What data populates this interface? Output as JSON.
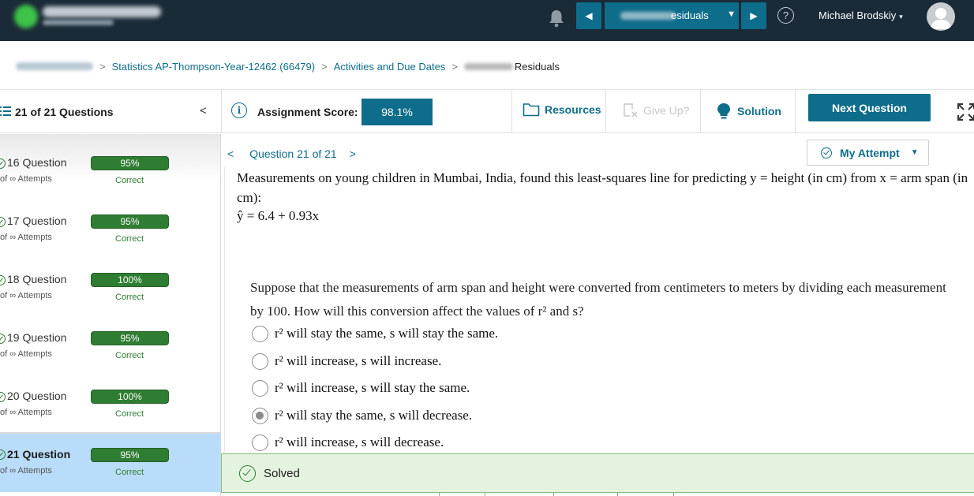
{
  "topbar": {
    "assignment_select_suffix": "esiduals",
    "nav_prev": "◀",
    "nav_next": "▶",
    "help": "?",
    "user_name": "Michael Brodskiy",
    "user_caret": "▾",
    "select_caret": "▼"
  },
  "breadcrumb": {
    "course": "Statistics AP-Thompson-Year-12462 (66479)",
    "activities": "Activities and Due Dates",
    "current": "Residuals",
    "separator": ">"
  },
  "sidebar": {
    "title": "21 of 21 Questions",
    "collapse": "<",
    "items": [
      {
        "title": "16 Question",
        "attempts": "of ∞ Attempts",
        "score": "95%",
        "status": "Correct"
      },
      {
        "title": "17 Question",
        "attempts": "of ∞ Attempts",
        "score": "95%",
        "status": "Correct"
      },
      {
        "title": "18 Question",
        "attempts": "of ∞ Attempts",
        "score": "100%",
        "status": "Correct"
      },
      {
        "title": "19 Question",
        "attempts": "of ∞ Attempts",
        "score": "95%",
        "status": "Correct"
      },
      {
        "title": "20 Question",
        "attempts": "of ∞ Attempts",
        "score": "100%",
        "status": "Correct"
      },
      {
        "title": "21 Question",
        "attempts": "of ∞ Attempts",
        "score": "95%",
        "status": "Correct"
      }
    ],
    "active_index": 5
  },
  "toolbar": {
    "score_label": "Assignment Score:",
    "score_value": "98.1%",
    "resources": "Resources",
    "give_up": "Give Up?",
    "solution": "Solution",
    "next_question": "Next Question"
  },
  "question_nav": {
    "label": "Question 21 of 21",
    "prev": "<",
    "next": ">",
    "my_attempt": "My Attempt"
  },
  "content": {
    "stem_line": "Measurements on young children in Mumbai, India, found this least-squares line for predicting y = height (in cm) from x = arm span (in cm):",
    "equation": "ŷ = 6.4 + 0.93x",
    "question": "Suppose that the measurements of arm span and height were converted from centimeters to meters by dividing each measurement by 100. How will this conversion affect the values of r² and s?",
    "options": [
      {
        "text": "r² will stay the same, s will stay the same.",
        "selected": false
      },
      {
        "text": "r² will increase, s will increase.",
        "selected": false
      },
      {
        "text": "r² will increase, s will stay the same.",
        "selected": false
      },
      {
        "text": "r² will stay the same, s will decrease.",
        "selected": true
      },
      {
        "text": "r² will increase, s will decrease.",
        "selected": false
      }
    ]
  },
  "status": {
    "solved": "Solved"
  },
  "colors": {
    "topbar": "#1b2a37",
    "accent": "#0f6d8c",
    "correct_green": "#2f7d32",
    "active_row": "#b9dcfa",
    "solved_bg": "#e3f3df"
  }
}
